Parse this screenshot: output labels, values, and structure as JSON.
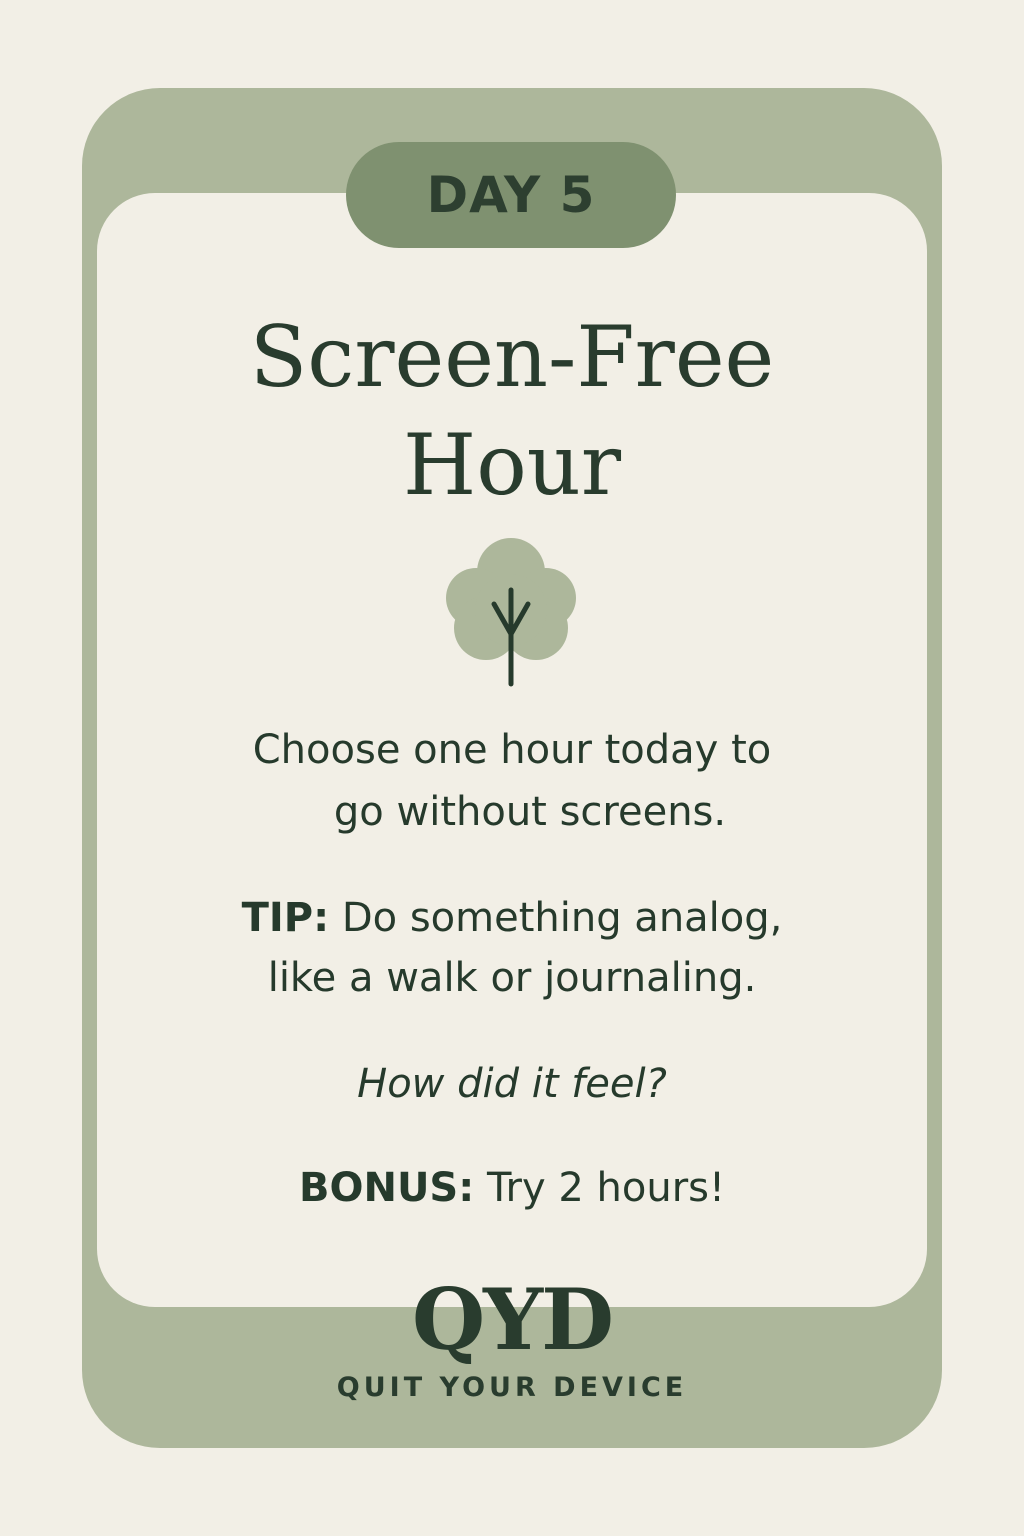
{
  "card": {
    "day_label": "DAY 5",
    "title_line1": "Screen-Free",
    "title_line2": "Hour",
    "icon": "tree-icon",
    "instruction_line1": "Choose one hour today to",
    "instruction_line2": "go without screens.",
    "tip_label": "TIP:",
    "tip_line1": " Do something analog,",
    "tip_line2": "like a walk or journaling.",
    "question": "How did it feel?",
    "bonus_label": "BONUS:",
    "bonus_text": " Try 2 hours!"
  },
  "brand": {
    "logo": "QYD",
    "tagline": "QUIT YOUR DEVICE"
  },
  "colors": {
    "background": "#f2efe6",
    "card_frame": "#adb79b",
    "badge": "#7f9170",
    "text": "#263a2c"
  }
}
